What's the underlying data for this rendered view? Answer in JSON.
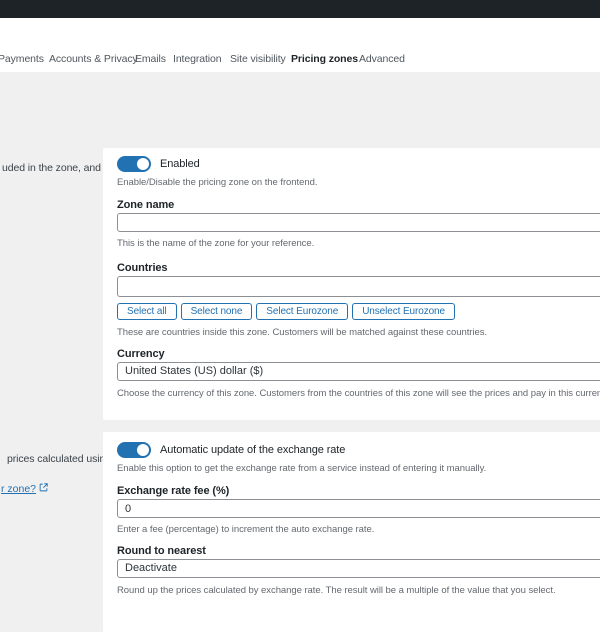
{
  "colors": {
    "admin_bar": "#1d2327",
    "page_background": "#f0f0f1",
    "accent_blue": "#2271b1",
    "active_tab_underline": "#72aee6"
  },
  "tabs": {
    "items": [
      {
        "label": "Payments"
      },
      {
        "label": "Accounts & Privacy"
      },
      {
        "label": "Emails"
      },
      {
        "label": "Integration"
      },
      {
        "label": "Site visibility"
      },
      {
        "label": "Pricing zones"
      },
      {
        "label": "Advanced"
      }
    ],
    "active": "Pricing zones"
  },
  "sidebar": {
    "fragment_zone_description": "uded in the zone, and",
    "fragment_exchange_description": "prices calculated using",
    "fragment_link_text": "r zone?",
    "link_icon": "external-link-icon"
  },
  "zone_card": {
    "enabled_toggle": {
      "label": "Enabled",
      "state": "on",
      "description": "Enable/Disable the pricing zone on the frontend."
    },
    "zone_name": {
      "label": "Zone name",
      "value": "",
      "description": "This is the name of the zone for your reference."
    },
    "countries": {
      "label": "Countries",
      "value": "",
      "buttons": [
        "Select all",
        "Select none",
        "Select Eurozone",
        "Unselect Eurozone"
      ],
      "description": "These are countries inside this zone. Customers will be matched against these countries."
    },
    "currency": {
      "label": "Currency",
      "value": "United States (US) dollar ($)",
      "description": "Choose the currency of this zone. Customers from the countries of this zone will see the prices and pay in this currency."
    }
  },
  "exchange_card": {
    "auto_update_toggle": {
      "label": "Automatic update of the exchange rate",
      "state": "on",
      "description": "Enable this option to get the exchange rate from a service instead of entering it manually."
    },
    "exchange_rate_fee": {
      "label": "Exchange rate fee (%)",
      "value": "0",
      "description": "Enter a fee (percentage) to increment the auto exchange rate."
    },
    "round_to_nearest": {
      "label": "Round to nearest",
      "value": "Deactivate",
      "description": "Round up the prices calculated by exchange rate. The result will be a multiple of the value that you select."
    }
  }
}
